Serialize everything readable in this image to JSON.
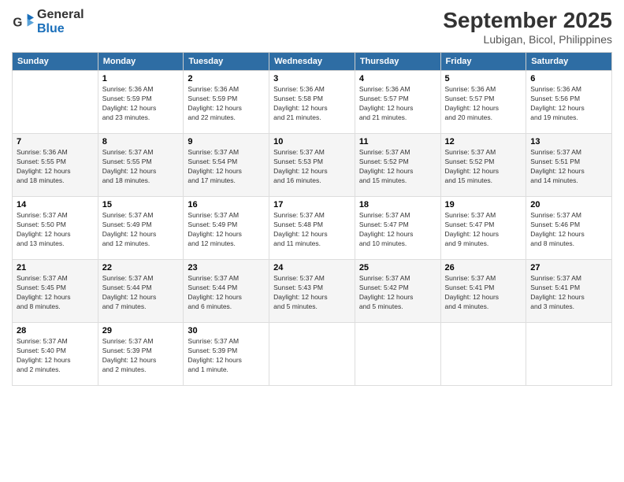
{
  "header": {
    "logo_line1": "General",
    "logo_line2": "Blue",
    "month": "September 2025",
    "location": "Lubigan, Bicol, Philippines"
  },
  "days_of_week": [
    "Sunday",
    "Monday",
    "Tuesday",
    "Wednesday",
    "Thursday",
    "Friday",
    "Saturday"
  ],
  "weeks": [
    [
      {
        "day": "",
        "info": ""
      },
      {
        "day": "1",
        "info": "Sunrise: 5:36 AM\nSunset: 5:59 PM\nDaylight: 12 hours\nand 23 minutes."
      },
      {
        "day": "2",
        "info": "Sunrise: 5:36 AM\nSunset: 5:59 PM\nDaylight: 12 hours\nand 22 minutes."
      },
      {
        "day": "3",
        "info": "Sunrise: 5:36 AM\nSunset: 5:58 PM\nDaylight: 12 hours\nand 21 minutes."
      },
      {
        "day": "4",
        "info": "Sunrise: 5:36 AM\nSunset: 5:57 PM\nDaylight: 12 hours\nand 21 minutes."
      },
      {
        "day": "5",
        "info": "Sunrise: 5:36 AM\nSunset: 5:57 PM\nDaylight: 12 hours\nand 20 minutes."
      },
      {
        "day": "6",
        "info": "Sunrise: 5:36 AM\nSunset: 5:56 PM\nDaylight: 12 hours\nand 19 minutes."
      }
    ],
    [
      {
        "day": "7",
        "info": "Sunrise: 5:36 AM\nSunset: 5:55 PM\nDaylight: 12 hours\nand 18 minutes."
      },
      {
        "day": "8",
        "info": "Sunrise: 5:37 AM\nSunset: 5:55 PM\nDaylight: 12 hours\nand 18 minutes."
      },
      {
        "day": "9",
        "info": "Sunrise: 5:37 AM\nSunset: 5:54 PM\nDaylight: 12 hours\nand 17 minutes."
      },
      {
        "day": "10",
        "info": "Sunrise: 5:37 AM\nSunset: 5:53 PM\nDaylight: 12 hours\nand 16 minutes."
      },
      {
        "day": "11",
        "info": "Sunrise: 5:37 AM\nSunset: 5:52 PM\nDaylight: 12 hours\nand 15 minutes."
      },
      {
        "day": "12",
        "info": "Sunrise: 5:37 AM\nSunset: 5:52 PM\nDaylight: 12 hours\nand 15 minutes."
      },
      {
        "day": "13",
        "info": "Sunrise: 5:37 AM\nSunset: 5:51 PM\nDaylight: 12 hours\nand 14 minutes."
      }
    ],
    [
      {
        "day": "14",
        "info": "Sunrise: 5:37 AM\nSunset: 5:50 PM\nDaylight: 12 hours\nand 13 minutes."
      },
      {
        "day": "15",
        "info": "Sunrise: 5:37 AM\nSunset: 5:49 PM\nDaylight: 12 hours\nand 12 minutes."
      },
      {
        "day": "16",
        "info": "Sunrise: 5:37 AM\nSunset: 5:49 PM\nDaylight: 12 hours\nand 12 minutes."
      },
      {
        "day": "17",
        "info": "Sunrise: 5:37 AM\nSunset: 5:48 PM\nDaylight: 12 hours\nand 11 minutes."
      },
      {
        "day": "18",
        "info": "Sunrise: 5:37 AM\nSunset: 5:47 PM\nDaylight: 12 hours\nand 10 minutes."
      },
      {
        "day": "19",
        "info": "Sunrise: 5:37 AM\nSunset: 5:47 PM\nDaylight: 12 hours\nand 9 minutes."
      },
      {
        "day": "20",
        "info": "Sunrise: 5:37 AM\nSunset: 5:46 PM\nDaylight: 12 hours\nand 8 minutes."
      }
    ],
    [
      {
        "day": "21",
        "info": "Sunrise: 5:37 AM\nSunset: 5:45 PM\nDaylight: 12 hours\nand 8 minutes."
      },
      {
        "day": "22",
        "info": "Sunrise: 5:37 AM\nSunset: 5:44 PM\nDaylight: 12 hours\nand 7 minutes."
      },
      {
        "day": "23",
        "info": "Sunrise: 5:37 AM\nSunset: 5:44 PM\nDaylight: 12 hours\nand 6 minutes."
      },
      {
        "day": "24",
        "info": "Sunrise: 5:37 AM\nSunset: 5:43 PM\nDaylight: 12 hours\nand 5 minutes."
      },
      {
        "day": "25",
        "info": "Sunrise: 5:37 AM\nSunset: 5:42 PM\nDaylight: 12 hours\nand 5 minutes."
      },
      {
        "day": "26",
        "info": "Sunrise: 5:37 AM\nSunset: 5:41 PM\nDaylight: 12 hours\nand 4 minutes."
      },
      {
        "day": "27",
        "info": "Sunrise: 5:37 AM\nSunset: 5:41 PM\nDaylight: 12 hours\nand 3 minutes."
      }
    ],
    [
      {
        "day": "28",
        "info": "Sunrise: 5:37 AM\nSunset: 5:40 PM\nDaylight: 12 hours\nand 2 minutes."
      },
      {
        "day": "29",
        "info": "Sunrise: 5:37 AM\nSunset: 5:39 PM\nDaylight: 12 hours\nand 2 minutes."
      },
      {
        "day": "30",
        "info": "Sunrise: 5:37 AM\nSunset: 5:39 PM\nDaylight: 12 hours\nand 1 minute."
      },
      {
        "day": "",
        "info": ""
      },
      {
        "day": "",
        "info": ""
      },
      {
        "day": "",
        "info": ""
      },
      {
        "day": "",
        "info": ""
      }
    ]
  ]
}
